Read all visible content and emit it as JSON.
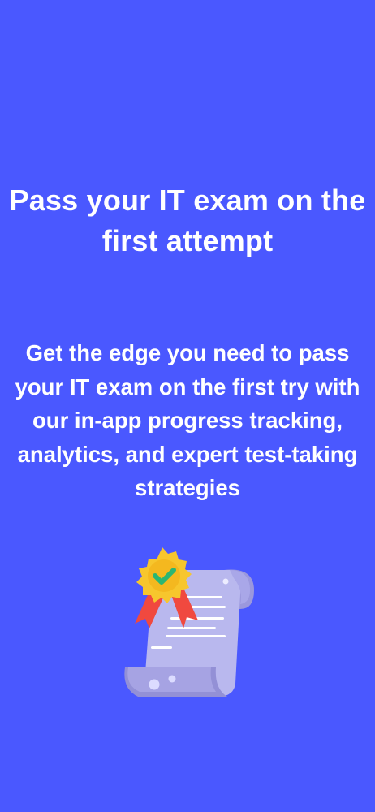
{
  "onboarding": {
    "headline": "Pass your IT exam on the first attempt",
    "subtext": "Get the edge you need to pass your IT exam on the first try with our in-app progress tracking, analytics, and expert test-taking strategies",
    "illustration": "certificate-with-award-badge-icon"
  },
  "colors": {
    "background": "#4a58ff",
    "text": "#ffffff",
    "scroll": "#b9b8ee",
    "scroll_shadow": "#9b98dd",
    "badge": "#f7c62d",
    "ribbon": "#f0493f",
    "check": "#2bb673"
  }
}
